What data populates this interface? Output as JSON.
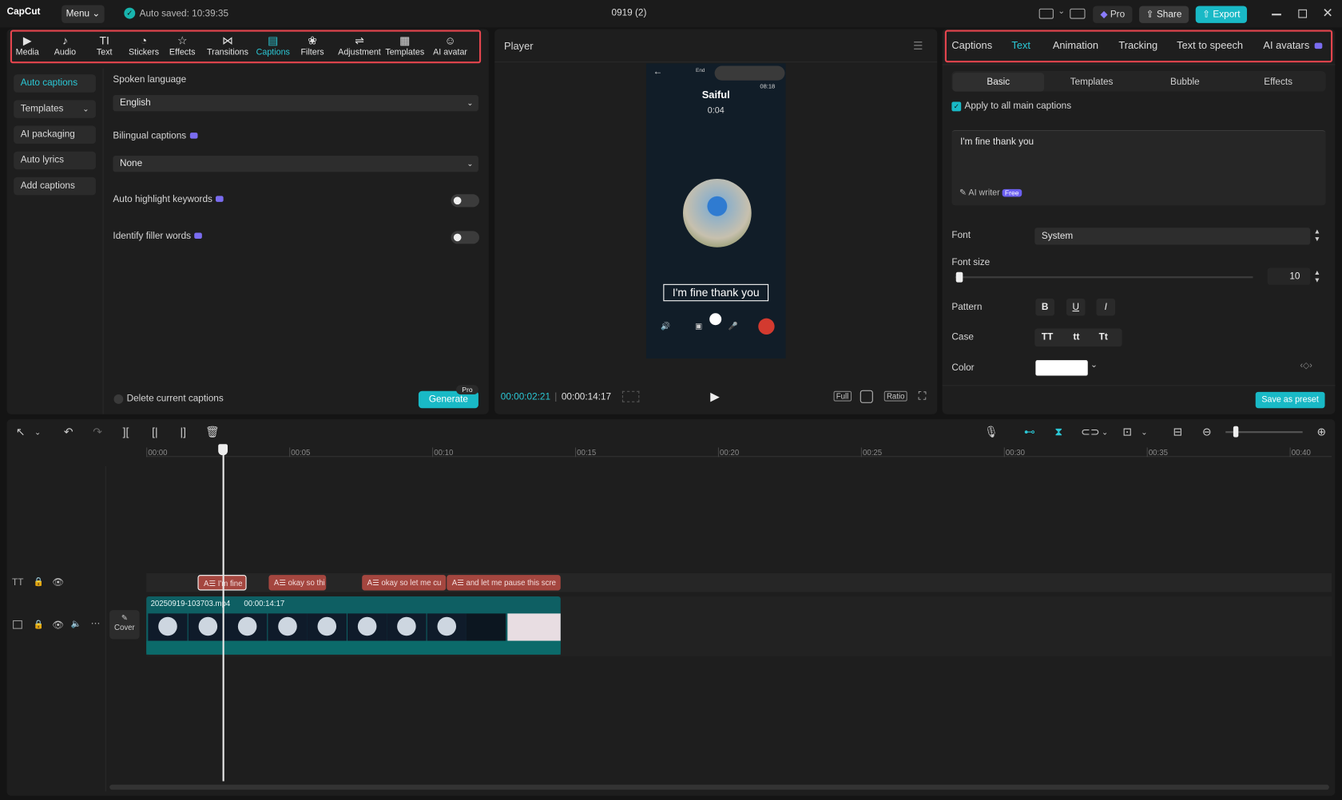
{
  "titlebar": {
    "logo": "CapCut",
    "menu": "Menu",
    "autosave": "Auto saved: 10:39:35",
    "project": "0919 (2)",
    "pro": "Pro",
    "share": "Share",
    "export": "Export"
  },
  "toolbar": [
    {
      "label": "Media",
      "icon": "media-icon"
    },
    {
      "label": "Audio",
      "icon": "audio-icon"
    },
    {
      "label": "Text",
      "icon": "text-icon"
    },
    {
      "label": "Stickers",
      "icon": "stickers-icon"
    },
    {
      "label": "Effects",
      "icon": "effects-icon"
    },
    {
      "label": "Transitions",
      "icon": "transitions-icon"
    },
    {
      "label": "Captions",
      "icon": "captions-icon",
      "active": true
    },
    {
      "label": "Filters",
      "icon": "filters-icon"
    },
    {
      "label": "Adjustment",
      "icon": "adjustment-icon"
    },
    {
      "label": "Templates",
      "icon": "templates-icon"
    },
    {
      "label": "AI avatar",
      "icon": "ai-avatar-icon"
    }
  ],
  "captions_panel": {
    "side": [
      "Auto captions",
      "Templates",
      "AI packaging",
      "Auto lyrics",
      "Add captions"
    ],
    "spoken_language_label": "Spoken language",
    "spoken_language_value": "English",
    "bilingual_label": "Bilingual captions",
    "bilingual_value": "None",
    "highlight_label": "Auto highlight keywords",
    "filler_label": "Identify filler words",
    "delete_label": "Delete current captions",
    "generate": "Generate",
    "pro_badge": "Pro"
  },
  "player": {
    "title": "Player",
    "current_time": "00:00:02:21",
    "total_time": "00:00:14:17",
    "full": "Full",
    "ratio": "Ratio",
    "phone_name": "Saiful",
    "phone_timer": "0:04",
    "phone_clock": "08:18",
    "phone_end": "End",
    "caption_text": "I'm fine thank you"
  },
  "right_panel": {
    "tabs": [
      "Captions",
      "Text",
      "Animation",
      "Tracking",
      "Text to speech",
      "AI avatars"
    ],
    "active_tab": "Text",
    "subtabs": [
      "Basic",
      "Templates",
      "Bubble",
      "Effects"
    ],
    "apply_all": "Apply to all main captions",
    "text_value": "I'm fine thank you",
    "ai_writer": "AI writer",
    "free_badge": "Free",
    "font_label": "Font",
    "font_value": "System",
    "font_size_label": "Font size",
    "font_size_value": "10",
    "pattern_label": "Pattern",
    "pattern": [
      "B",
      "U",
      "I"
    ],
    "case_label": "Case",
    "case": [
      "TT",
      "tt",
      "Tt"
    ],
    "color_label": "Color",
    "color_value": "#ffffff",
    "save_preset": "Save as preset"
  },
  "timeline": {
    "ruler": [
      "00:00",
      "00:05",
      "00:10",
      "00:15",
      "00:20",
      "00:25",
      "00:30",
      "00:35",
      "00:40"
    ],
    "caption_clips": [
      "I'm fine",
      "okay so thi",
      "okay so let me cu",
      "and let me pause this scre"
    ],
    "video_file": "20250919-103703.mp4",
    "video_duration": "00:00:14:17",
    "cover": "Cover"
  },
  "colors": {
    "accent": "#2bc8d6",
    "highlight_border": "#e5454e",
    "caption_clip": "#a4463f",
    "video_clip": "#0e5f63"
  }
}
